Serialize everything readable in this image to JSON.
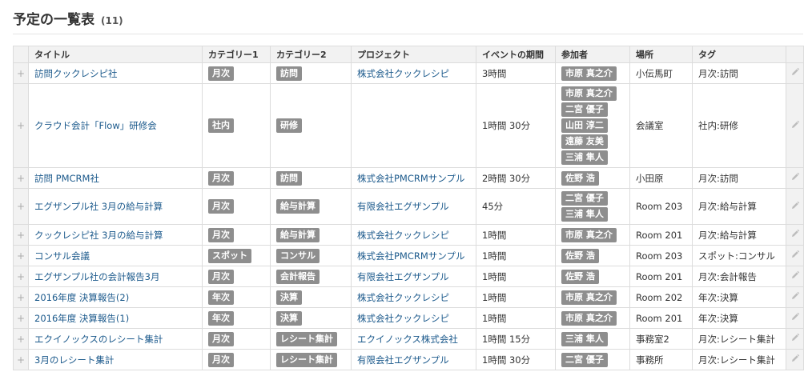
{
  "header": {
    "title": "予定の一覧表",
    "count": "(11)"
  },
  "columns": [
    "タイトル",
    "カテゴリー1",
    "カテゴリー2",
    "プロジェクト",
    "イベントの期間",
    "参加者",
    "場所",
    "タグ"
  ],
  "rows": [
    {
      "title": "訪問クックレシピ社",
      "cat1": "月次",
      "cat2": "訪問",
      "project": "株式会社クックレシピ",
      "duration": "3時間",
      "participants": [
        "市原 真之介"
      ],
      "place": "小伝馬町",
      "tag": "月次:訪問"
    },
    {
      "title": "クラウド会計「Flow」研修会",
      "cat1": "社内",
      "cat2": "研修",
      "project": "",
      "duration": "1時間 30分",
      "participants": [
        "市原 真之介",
        "二宮 優子",
        "山田 淳二",
        "遠藤 友美",
        "三浦 隼人"
      ],
      "place": "会議室",
      "tag": "社内:研修"
    },
    {
      "title": "訪問 PMCRM社",
      "cat1": "月次",
      "cat2": "訪問",
      "project": "株式会社PMCRMサンプル",
      "duration": "2時間 30分",
      "participants": [
        "佐野 浩"
      ],
      "place": "小田原",
      "tag": "月次:訪問"
    },
    {
      "title": "エグザンプル社 3月の給与計算",
      "cat1": "月次",
      "cat2": "給与計算",
      "project": "有限会社エグザンプル",
      "duration": "45分",
      "participants": [
        "二宮 優子",
        "三浦 隼人"
      ],
      "place": "Room 203",
      "tag": "月次:給与計算"
    },
    {
      "title": "クックレシピ社 3月の給与計算",
      "cat1": "月次",
      "cat2": "給与計算",
      "project": "株式会社クックレシピ",
      "duration": "1時間",
      "participants": [
        "市原 真之介"
      ],
      "place": "Room 201",
      "tag": "月次:給与計算"
    },
    {
      "title": "コンサル会議",
      "cat1": "スポット",
      "cat2": "コンサル",
      "project": "株式会社PMCRMサンプル",
      "duration": "1時間",
      "participants": [
        "佐野 浩"
      ],
      "place": "Room 203",
      "tag": "スポット:コンサル"
    },
    {
      "title": "エグザンプル社の会計報告3月",
      "cat1": "月次",
      "cat2": "会計報告",
      "project": "有限会社エグザンプル",
      "duration": "1時間",
      "participants": [
        "佐野 浩"
      ],
      "place": "Room 201",
      "tag": "月次:会計報告"
    },
    {
      "title": "2016年度 決算報告(2)",
      "cat1": "年次",
      "cat2": "決算",
      "project": "株式会社クックレシピ",
      "duration": "1時間",
      "participants": [
        "市原 真之介"
      ],
      "place": "Room 202",
      "tag": "年次:決算"
    },
    {
      "title": "2016年度 決算報告(1)",
      "cat1": "年次",
      "cat2": "決算",
      "project": "株式会社クックレシピ",
      "duration": "1時間",
      "participants": [
        "市原 真之介"
      ],
      "place": "Room 201",
      "tag": "年次:決算"
    },
    {
      "title": "エクイノックスのレシート集計",
      "cat1": "月次",
      "cat2": "レシート集計",
      "project": "エクイノックス株式会社",
      "duration": "1時間 15分",
      "participants": [
        "三浦 隼人"
      ],
      "place": "事務室2",
      "tag": "月次:レシート集計"
    },
    {
      "title": "3月のレシート集計",
      "cat1": "月次",
      "cat2": "レシート集計",
      "project": "有限会社エグザンプル",
      "duration": "1時間 30分",
      "participants": [
        "二宮 優子"
      ],
      "place": "事務所",
      "tag": "月次:レシート集計"
    }
  ],
  "icons": {
    "expand": "plus-icon",
    "edit": "pencil-icon"
  }
}
